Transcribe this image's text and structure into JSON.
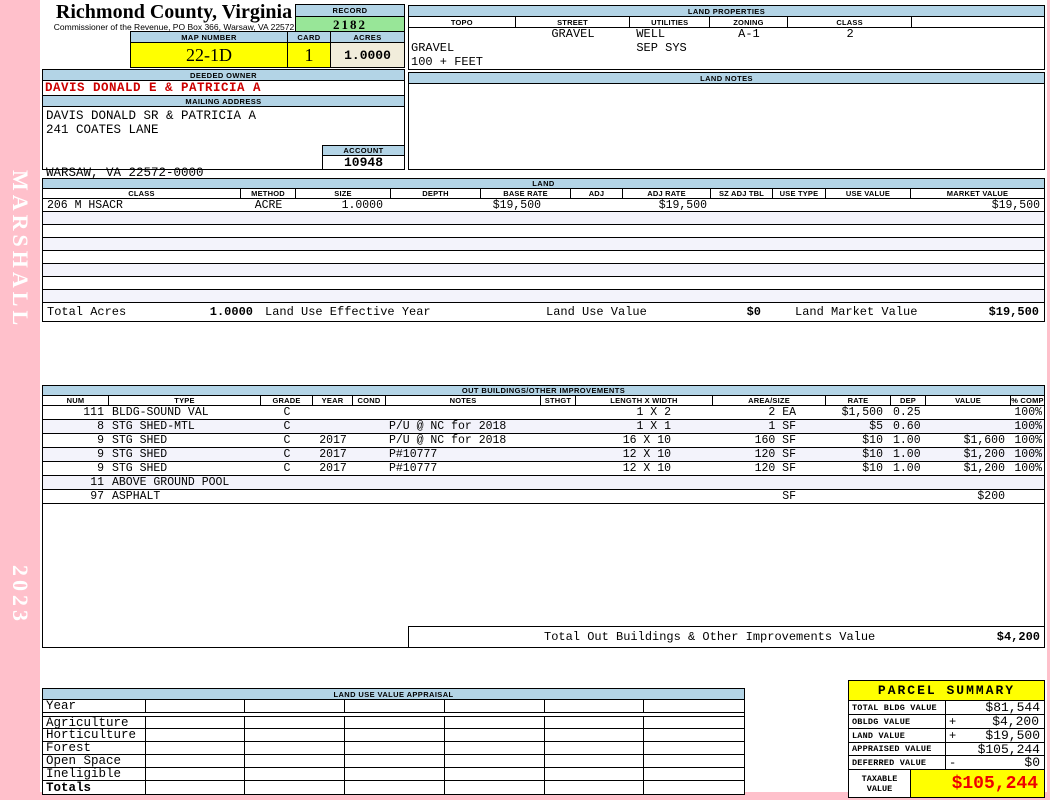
{
  "colors": {
    "page_background": "#FFC0CB",
    "section_header_blue": "#B3D4E6",
    "record_green": "#98E698",
    "highlight_yellow": "#FFFF00",
    "acres_cream": "#F1EDDB",
    "owner_red": "#CC0000",
    "taxable_red": "#EE0000"
  },
  "sidebar": {
    "vendor": "MARSHALL",
    "year": "2023"
  },
  "header": {
    "county": "Richmond County, Virginia",
    "subtitle": "Commissioner of the Revenue, PO Box 366, Warsaw, VA 22572",
    "record_label": "RECORD",
    "record_value": "2182",
    "map_label": "MAP NUMBER",
    "map_value": "22-1D",
    "card_label": "CARD",
    "card_value": "1",
    "acres_label": "ACRES",
    "acres_value": "1.0000",
    "owner_label": "DEEDED OWNER",
    "owner_value": "DAVIS DONALD E & PATRICIA A",
    "mailing_label": "MAILING ADDRESS",
    "mailing_line1": "DAVIS DONALD SR & PATRICIA A",
    "mailing_line2": "241 COATES LANE",
    "mailing_line3": "WARSAW, VA 22572-0000",
    "account_label": "ACCOUNT",
    "account_value": "10948"
  },
  "land_properties": {
    "title": "LAND PROPERTIES",
    "headers": [
      "TOPO",
      "STREET",
      "UTILITIES",
      "ZONING",
      "CLASS"
    ],
    "row1": {
      "street": "GRAVEL",
      "utilities": "WELL",
      "zoning": "A-1",
      "class": "2"
    },
    "row2": {
      "topo": "GRAVEL",
      "utilities": "SEP SYS"
    },
    "row3": {
      "topo": "100 + FEET"
    }
  },
  "land_notes": {
    "title": "LAND NOTES"
  },
  "land": {
    "title": "LAND",
    "headers": [
      "CLASS",
      "METHOD",
      "SIZE",
      "DEPTH",
      "BASE RATE",
      "ADJ",
      "ADJ RATE",
      "SZ ADJ TBL",
      "USE TYPE",
      "USE VALUE",
      "MARKET VALUE"
    ],
    "rows": [
      {
        "class": "206 M HSACR",
        "method": "ACRE",
        "size": "1.0000",
        "depth": "",
        "base_rate": "$19,500",
        "adj": "",
        "adj_rate": "$19,500",
        "sz_adj_tbl": "",
        "use_type": "",
        "use_value": "",
        "market_value": "$19,500"
      }
    ],
    "totals": {
      "acres_label": "Total Acres",
      "acres_value": "1.0000",
      "effective_year_label": "Land Use Effective Year",
      "use_value_label": "Land Use Value",
      "use_value": "$0",
      "market_value_label": "Land Market Value",
      "market_value": "$19,500"
    }
  },
  "outbuildings": {
    "title": "OUT BUILDINGS/OTHER IMPROVEMENTS",
    "headers": [
      "NUM",
      "TYPE",
      "GRADE",
      "YEAR",
      "COND",
      "NOTES",
      "STHGT",
      "LENGTH X WIDTH",
      "AREA/SIZE",
      "RATE",
      "DEP",
      "VALUE",
      "% COMP"
    ],
    "rows": [
      {
        "num": "111",
        "type": "BLDG-SOUND VAL",
        "grade": "C",
        "year": "",
        "cond": "",
        "notes": "",
        "sthgt": "",
        "lw": "1 X 2",
        "area": "2 EA",
        "rate": "$1,500",
        "dep": "0.25",
        "value": "",
        "comp": "100%"
      },
      {
        "num": "8",
        "type": "STG SHED-MTL",
        "grade": "C",
        "year": "",
        "cond": "",
        "notes": "P/U @ NC for 2018",
        "sthgt": "",
        "lw": "1 X 1",
        "area": "1 SF",
        "rate": "$5",
        "dep": "0.60",
        "value": "",
        "comp": "100%"
      },
      {
        "num": "9",
        "type": "STG SHED",
        "grade": "C",
        "year": "2017",
        "cond": "",
        "notes": "P/U @ NC for 2018",
        "sthgt": "",
        "lw": "16 X 10",
        "area": "160 SF",
        "rate": "$10",
        "dep": "1.00",
        "value": "$1,600",
        "comp": "100%"
      },
      {
        "num": "9",
        "type": "STG SHED",
        "grade": "C",
        "year": "2017",
        "cond": "",
        "notes": "P#10777",
        "sthgt": "",
        "lw": "12 X 10",
        "area": "120 SF",
        "rate": "$10",
        "dep": "1.00",
        "value": "$1,200",
        "comp": "100%"
      },
      {
        "num": "9",
        "type": "STG SHED",
        "grade": "C",
        "year": "2017",
        "cond": "",
        "notes": "P#10777",
        "sthgt": "",
        "lw": "12 X 10",
        "area": "120 SF",
        "rate": "$10",
        "dep": "1.00",
        "value": "$1,200",
        "comp": "100%"
      },
      {
        "num": "11",
        "type": "ABOVE GROUND POOL",
        "grade": "",
        "year": "",
        "cond": "",
        "notes": "",
        "sthgt": "",
        "lw": "",
        "area": "",
        "rate": "",
        "dep": "",
        "value": "",
        "comp": ""
      },
      {
        "num": "97",
        "type": "ASPHALT",
        "grade": "",
        "year": "",
        "cond": "",
        "notes": "",
        "sthgt": "",
        "lw": "",
        "area": "SF",
        "rate": "",
        "dep": "",
        "value": "$200",
        "comp": ""
      }
    ],
    "total_label": "Total Out Buildings & Other Improvements Value",
    "total_value": "$4,200"
  },
  "land_use_appraisal": {
    "title": "LAND USE VALUE APPRAISAL",
    "row_labels": [
      "Year",
      "Agriculture",
      "Horticulture",
      "Forest",
      "Open Space",
      "Ineligible",
      "Totals"
    ]
  },
  "parcel_summary": {
    "title": "PARCEL SUMMARY",
    "rows": [
      {
        "label": "TOTAL BLDG VALUE",
        "op": "",
        "value": "$81,544"
      },
      {
        "label": "OBLDG VALUE",
        "op": "+",
        "value": "$4,200"
      },
      {
        "label": "LAND VALUE",
        "op": "+",
        "value": "$19,500"
      },
      {
        "label": "APPRAISED VALUE",
        "op": "",
        "value": "$105,244"
      },
      {
        "label": "DEFERRED VALUE",
        "op": "-",
        "value": "$0"
      }
    ],
    "taxable_label": "TAXABLE\nVALUE",
    "taxable_value": "$105,244"
  }
}
